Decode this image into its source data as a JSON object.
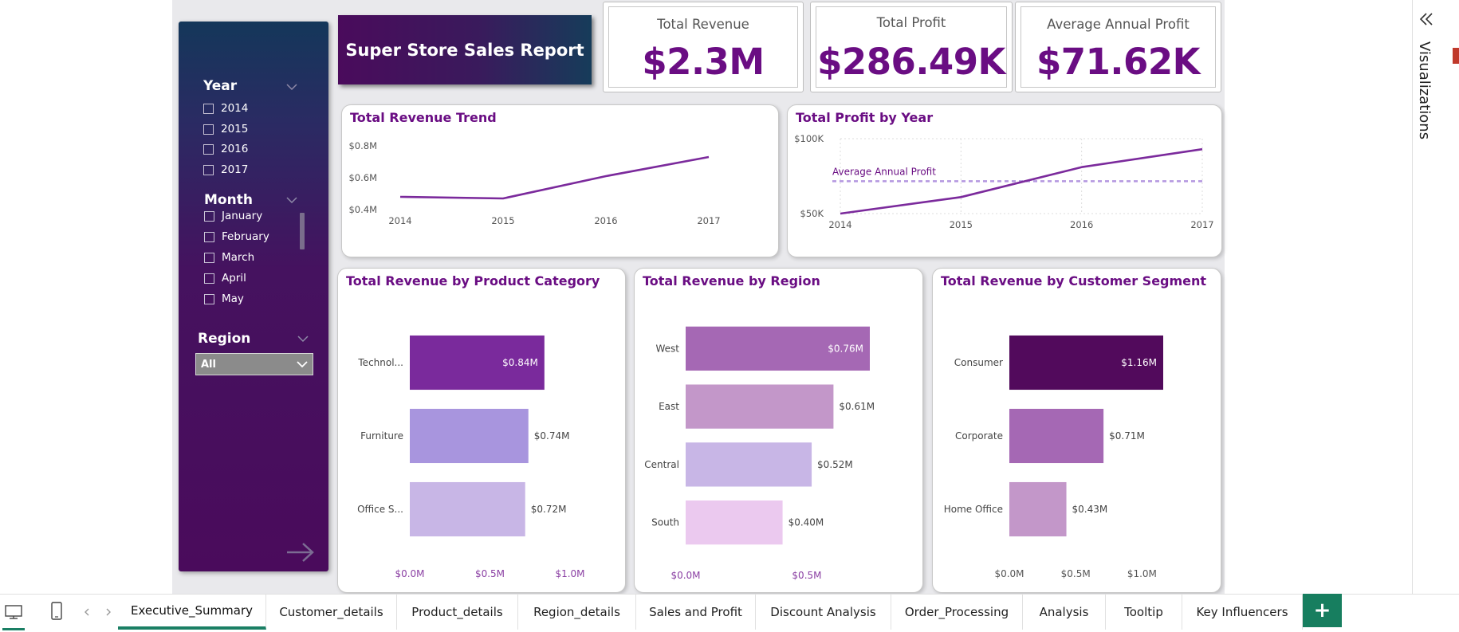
{
  "report": {
    "title": "Super Store Sales Report"
  },
  "kpis": [
    {
      "label": "Total Revenue",
      "value": "$2.3M"
    },
    {
      "label": "Total Profit",
      "value": "$286.49K"
    },
    {
      "label": "Average Annual Profit",
      "value": "$71.62K"
    }
  ],
  "slicers": {
    "year": {
      "title": "Year",
      "items": [
        "2014",
        "2015",
        "2016",
        "2017"
      ]
    },
    "month": {
      "title": "Month",
      "items": [
        "January",
        "February",
        "March",
        "April",
        "May"
      ]
    },
    "region": {
      "title": "Region",
      "selected": "All"
    }
  },
  "colors": {
    "accent": "#6a0d83",
    "line": "#7b2a9c",
    "dashed": "#b497e0"
  },
  "chart_data": [
    {
      "type": "line",
      "title": "Total Revenue Trend",
      "x": [
        "2014",
        "2015",
        "2016",
        "2017"
      ],
      "series": [
        {
          "values": [
            0.48,
            0.47,
            0.61,
            0.73
          ]
        }
      ],
      "yticks": [
        "$0.4M",
        "$0.6M",
        "$0.8M"
      ],
      "ylim": [
        0.4,
        0.8
      ],
      "grid": false
    },
    {
      "type": "line",
      "title": "Total Profit by Year",
      "x": [
        "2014",
        "2015",
        "2016",
        "2017"
      ],
      "series": [
        {
          "values": [
            50000,
            61000,
            81000,
            93000
          ]
        }
      ],
      "yticks": [
        "$50K",
        "$100K"
      ],
      "ylim": [
        50000,
        100000
      ],
      "reference_line": {
        "label": "Average Annual Profit",
        "value": 71620
      },
      "grid": true
    },
    {
      "type": "bar",
      "orientation": "horizontal",
      "title": "Total Revenue by Product Category",
      "categories": [
        "Technol...",
        "Furniture",
        "Office S..."
      ],
      "values": [
        0.84,
        0.74,
        0.72
      ],
      "labels": [
        "$0.84M",
        "$0.74M",
        "$0.72M"
      ],
      "colors": [
        "#7a2a9c",
        "#a895de",
        "#c8b6e6"
      ],
      "xticks": [
        "$0.0M",
        "$0.5M",
        "$1.0M"
      ],
      "xlim": [
        0,
        1.0
      ]
    },
    {
      "type": "bar",
      "orientation": "horizontal",
      "title": "Total Revenue by Region",
      "categories": [
        "West",
        "East",
        "Central",
        "South"
      ],
      "values": [
        0.76,
        0.61,
        0.52,
        0.4
      ],
      "labels": [
        "$0.76M",
        "$0.61M",
        "$0.52M",
        "$0.40M"
      ],
      "colors": [
        "#a568b4",
        "#c397c9",
        "#c8b6e6",
        "#ebc9ef"
      ],
      "xticks": [
        "$0.0M",
        "$0.5M"
      ],
      "xlim": [
        0,
        0.76
      ]
    },
    {
      "type": "bar",
      "orientation": "horizontal",
      "title": "Total Revenue by Customer Segment",
      "categories": [
        "Consumer",
        "Corporate",
        "Home Office"
      ],
      "values": [
        1.16,
        0.71,
        0.43
      ],
      "labels": [
        "$1.16M",
        "$0.71M",
        "$0.43M"
      ],
      "colors": [
        "#520a5c",
        "#a568b4",
        "#c397c9"
      ],
      "xticks": [
        "$0.0M",
        "$0.5M",
        "$1.0M"
      ],
      "xlim": [
        0,
        1.16
      ]
    }
  ],
  "visualizations_pane": {
    "label": "Visualizations"
  },
  "tabs": [
    {
      "label": "Executive_Summary",
      "active": true
    },
    {
      "label": "Customer_details"
    },
    {
      "label": "Product_details"
    },
    {
      "label": "Region_details"
    },
    {
      "label": "Sales and Profit"
    },
    {
      "label": "Discount Analysis"
    },
    {
      "label": "Order_Processing"
    },
    {
      "label": "Analysis"
    },
    {
      "label": "Tooltip"
    },
    {
      "label": "Key Influencers"
    }
  ],
  "add_page": {
    "label": "+"
  }
}
